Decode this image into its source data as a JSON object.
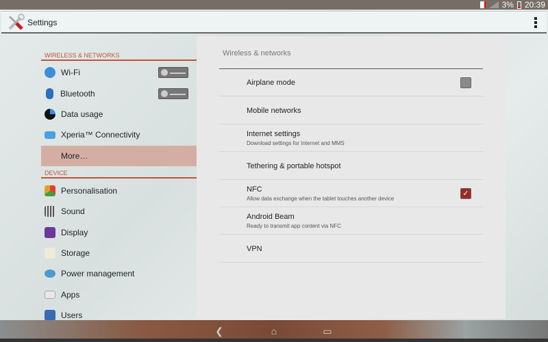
{
  "status": {
    "battery": "3%",
    "time": "20:39"
  },
  "actionbar": {
    "title": "Settings"
  },
  "sidebar": {
    "wireless_header": "WIRELESS & NETWORKS",
    "device_header": "DEVICE",
    "wireless_items": [
      {
        "label": "Wi-Fi",
        "color": "#3a8fdc"
      },
      {
        "label": "Bluetooth",
        "color": "#2a6fc0"
      },
      {
        "label": "Data usage",
        "color": "#1d2a3a"
      },
      {
        "label": "Xperia™ Connectivity",
        "color": "#4aa0e0"
      },
      {
        "label": "More…",
        "color": "transparent"
      }
    ],
    "device_items": [
      {
        "label": "Personalisation",
        "color": "#e0a030"
      },
      {
        "label": "Sound",
        "color": "#777777"
      },
      {
        "label": "Display",
        "color": "#6a3a9a"
      },
      {
        "label": "Storage",
        "color": "#e8e0c8"
      },
      {
        "label": "Power management",
        "color": "#4a9ad0"
      },
      {
        "label": "Apps",
        "color": "#d8d8d8"
      },
      {
        "label": "Users",
        "color": "#3a6ab0"
      }
    ]
  },
  "main": {
    "title": "Wireless & networks",
    "rows": [
      {
        "label": "Airplane mode",
        "sub": "",
        "checkbox": "off"
      },
      {
        "label": "Mobile networks",
        "sub": ""
      },
      {
        "label": "Internet settings",
        "sub": "Download settings for Internet and MMS"
      },
      {
        "label": "Tethering & portable hotspot",
        "sub": ""
      },
      {
        "label": "NFC",
        "sub": "Allow data exchange when the tablet touches another device",
        "checkbox": "on"
      },
      {
        "label": "Android Beam",
        "sub": "Ready to transmit app content via NFC"
      },
      {
        "label": "VPN",
        "sub": ""
      }
    ]
  }
}
